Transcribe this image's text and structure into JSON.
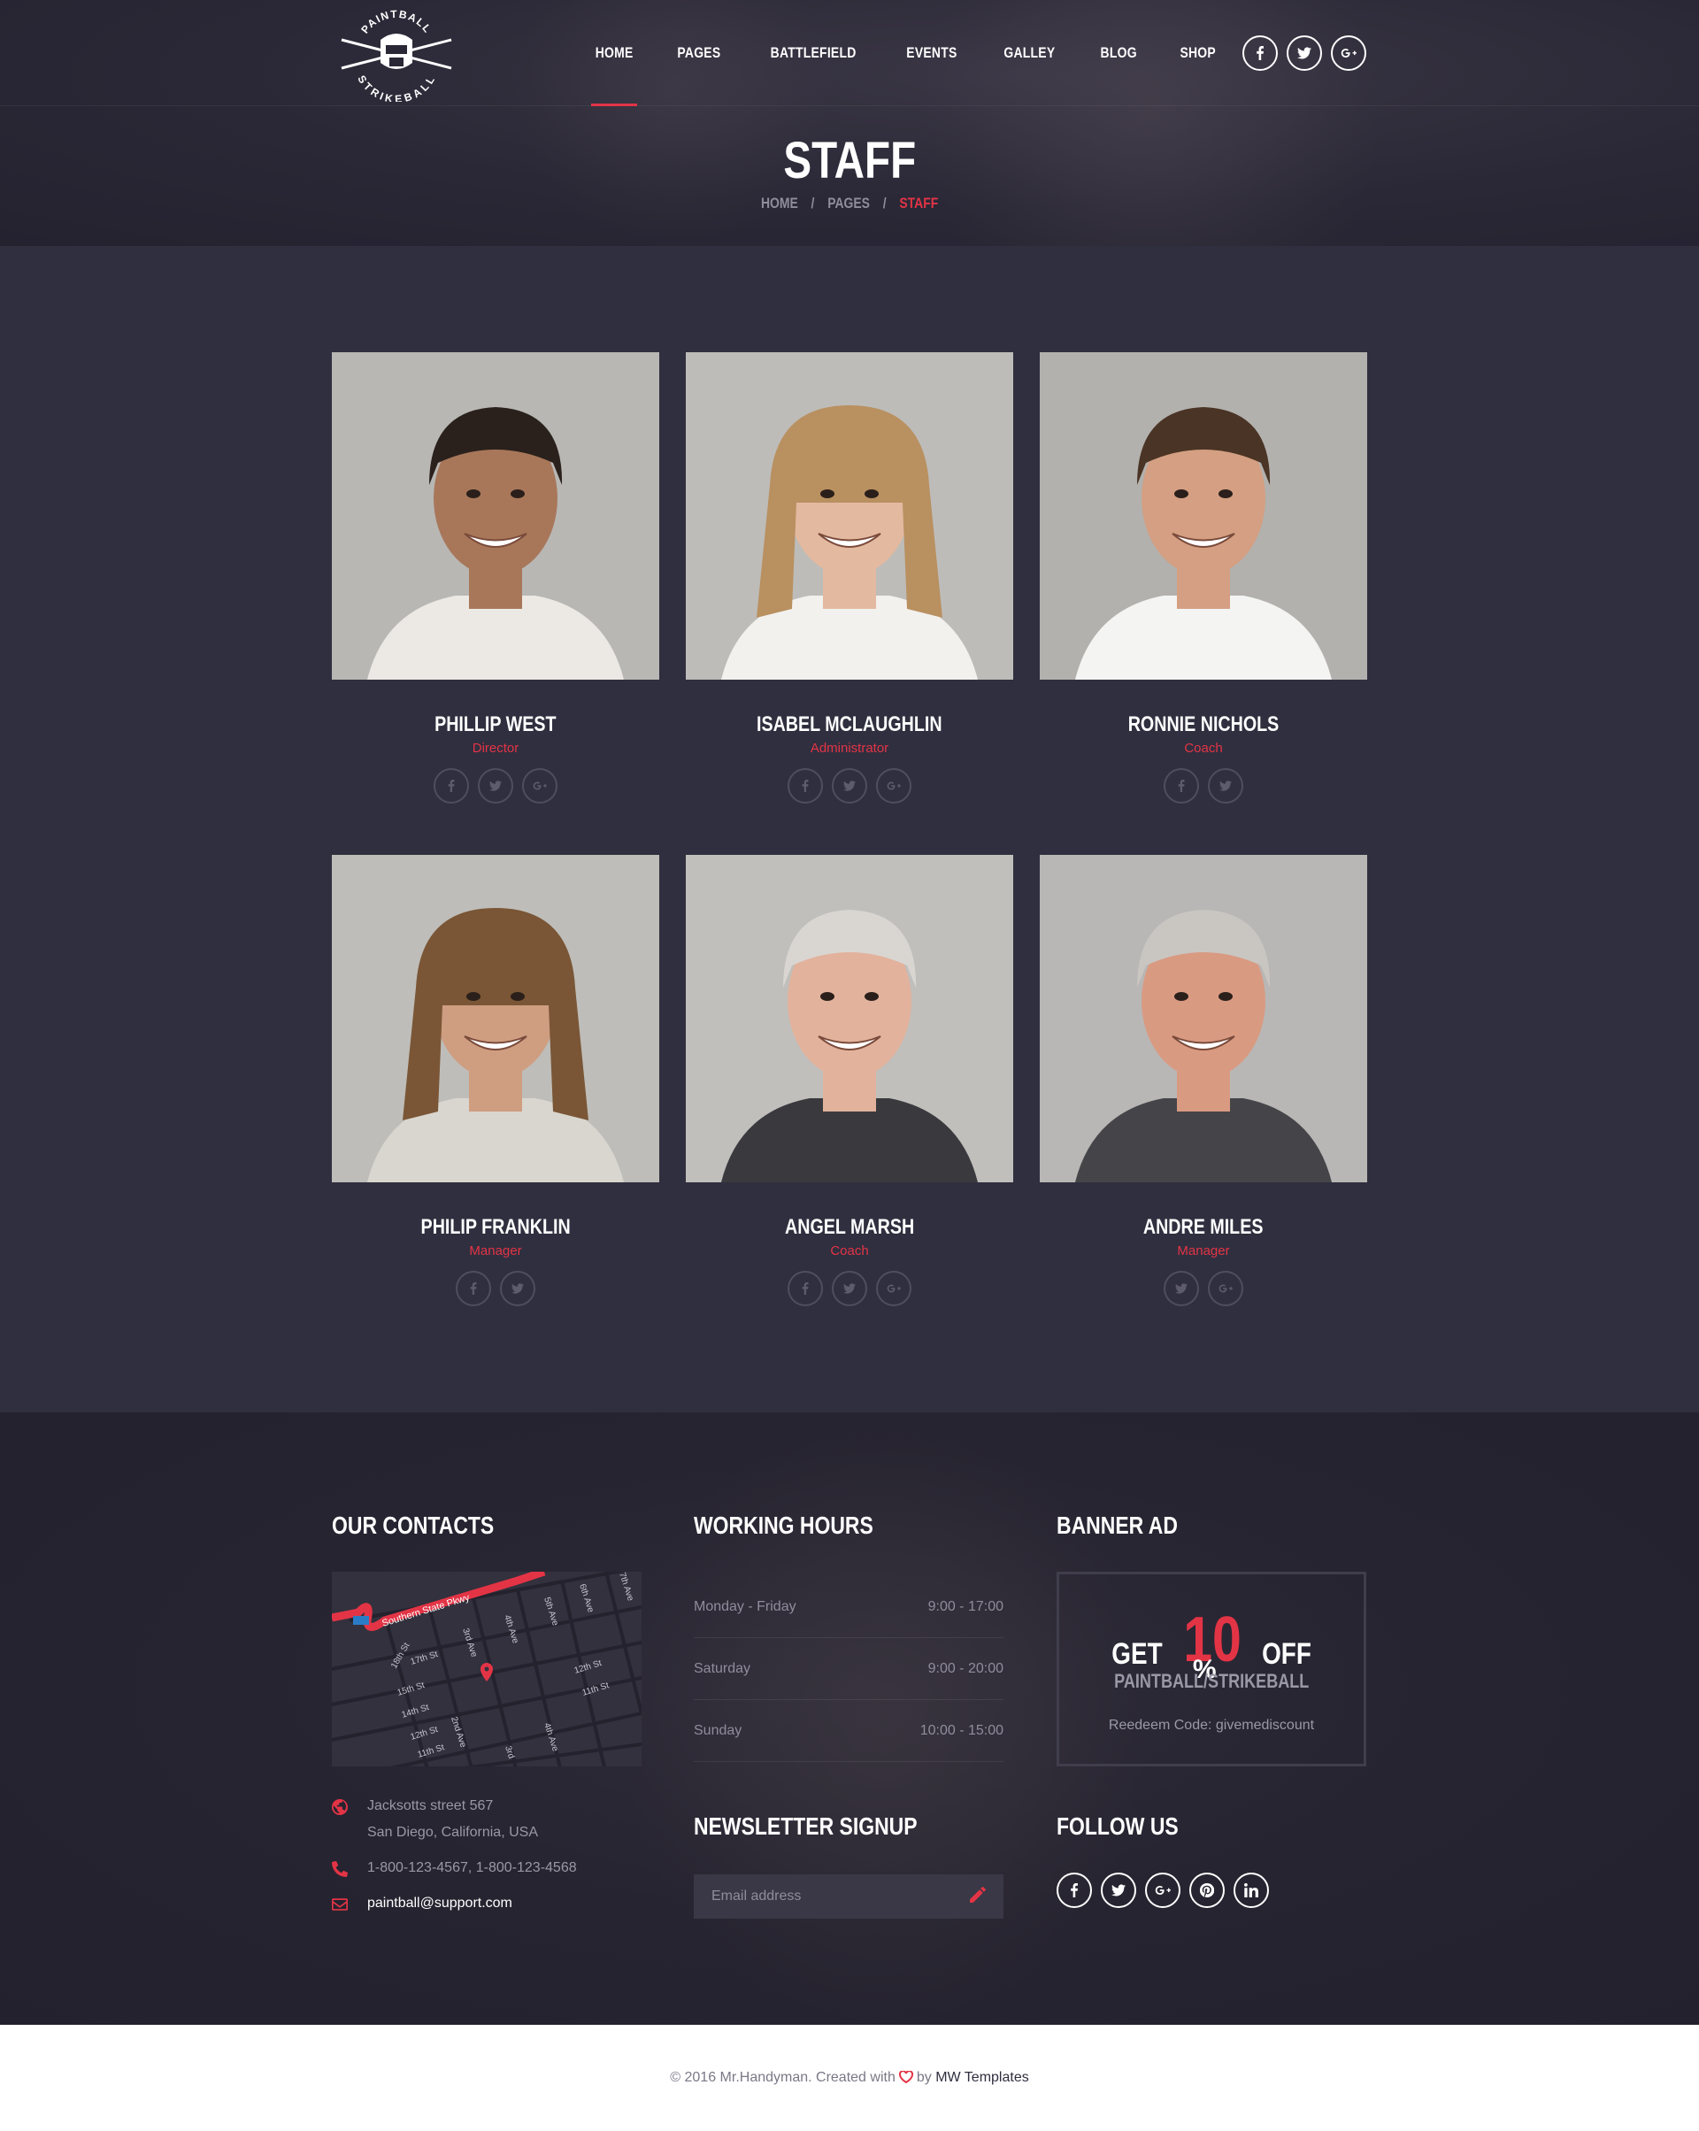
{
  "header": {
    "logo": {
      "top_text": "PAINTBALL",
      "bottom_text": "STRIKEBALL"
    },
    "nav": [
      {
        "label": "HOME",
        "active": true
      },
      {
        "label": "PAGES"
      },
      {
        "label": "BATTLEFIELD"
      },
      {
        "label": "EVENTS"
      },
      {
        "label": "GALLEY"
      },
      {
        "label": "BLOG"
      },
      {
        "label": "SHOP"
      }
    ],
    "social": [
      "facebook-icon",
      "twitter-icon",
      "google-plus-icon"
    ],
    "page_title": "STAFF",
    "breadcrumb": {
      "home": "HOME",
      "sep": "/",
      "pages": "PAGES",
      "current": "STAFF"
    }
  },
  "staff": [
    {
      "name": "PHILLIP WEST",
      "role": "Director",
      "social": [
        "facebook",
        "twitter",
        "google-plus"
      ]
    },
    {
      "name": "ISABEL MCLAUGHLIN",
      "role": "Administrator",
      "social": [
        "facebook",
        "twitter",
        "google-plus"
      ]
    },
    {
      "name": "RONNIE NICHOLS",
      "role": "Coach",
      "social": [
        "facebook",
        "twitter"
      ]
    },
    {
      "name": "PHILIP FRANKLIN",
      "role": "Manager",
      "social": [
        "facebook",
        "twitter"
      ]
    },
    {
      "name": "ANGEL MARSH",
      "role": "Coach",
      "social": [
        "facebook",
        "twitter",
        "google-plus"
      ]
    },
    {
      "name": "ANDRE MILES",
      "role": "Manager",
      "social": [
        "twitter",
        "google-plus"
      ]
    }
  ],
  "footer": {
    "contacts": {
      "heading": "OUR CONTACTS",
      "map_labels": [
        "Southern State Pkwy",
        "18th St",
        "17th St",
        "15th St",
        "14th St",
        "12th St",
        "11th St",
        "3rd Ave",
        "4th Ave",
        "5th Ave",
        "6th Ave",
        "7th Ave",
        "2nd Ave",
        "12th St",
        "11th St",
        "4th Ave",
        "3rd"
      ],
      "address_line1": "Jacksotts street 567",
      "address_line2": "San Diego, California, USA",
      "phone": "1-800-123-4567, 1-800-123-4568",
      "email": "paintball@support.com"
    },
    "hours": {
      "heading": "WORKING HOURS",
      "rows": [
        {
          "day": "Monday - Friday",
          "time": "9:00 - 17:00"
        },
        {
          "day": "Saturday",
          "time": "9:00 - 20:00"
        },
        {
          "day": "Sunday",
          "time": "10:00 - 15:00"
        }
      ]
    },
    "newsletter": {
      "heading": "NEWSLETTER SIGNUP",
      "placeholder": "Email address"
    },
    "banner": {
      "heading": "BANNER AD",
      "get": "GET",
      "amount": "10",
      "percent": "%",
      "off": "OFF",
      "subtitle": "PAINTBALL/STRIKEBALL",
      "code": "Reedeem Code: givemediscount"
    },
    "follow": {
      "heading": "FOLLOW US",
      "icons": [
        "facebook-icon",
        "twitter-icon",
        "google-plus-icon",
        "pinterest-icon",
        "linkedin-icon"
      ]
    }
  },
  "copyright": {
    "prefix": "© 2016 Mr.Handyman. Created with",
    "by": "by",
    "author": "MW Templates"
  },
  "colors": {
    "accent": "#e33446",
    "background": "#302f3f",
    "header": "#24222f"
  }
}
